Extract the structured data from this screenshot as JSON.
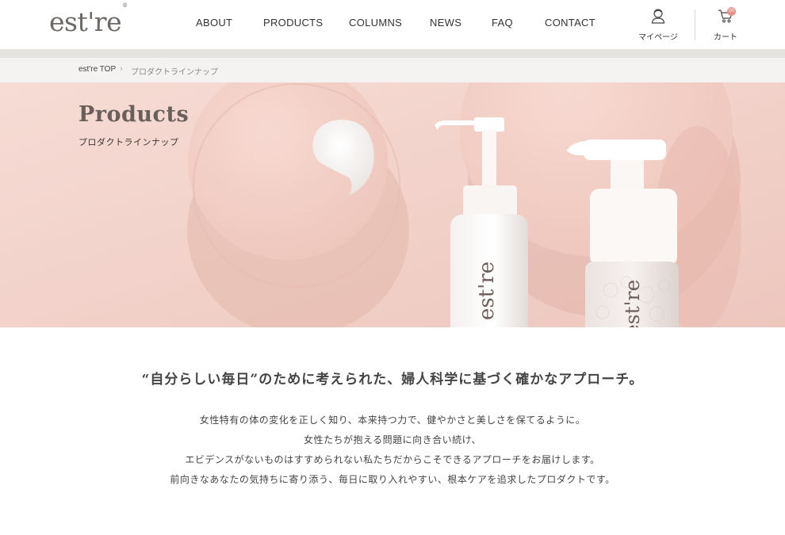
{
  "header": {
    "logo": "est're",
    "logo_mark": "®",
    "nav": [
      {
        "label": "ABOUT"
      },
      {
        "label": "PRODUCTS"
      },
      {
        "label": "COLUMNS"
      },
      {
        "label": "NEWS"
      },
      {
        "label": "FAQ"
      },
      {
        "label": "CONTACT"
      }
    ],
    "mypage_label": "マイページ",
    "cart_label": "カート",
    "cart_count": "00"
  },
  "breadcrumb": {
    "home": "est're TOP",
    "separator": "›",
    "current": "プロダクトラインナップ"
  },
  "hero": {
    "title": "Products",
    "subtitle": "プロダクトラインナップ",
    "bottle_brand": "est're"
  },
  "intro": {
    "heading": "“自分らしい毎日”のために考えられた、婦人科学に基づく確かなアプローチ。",
    "lines": [
      "女性特有の体の変化を正しく知り、本来持つ力で、健やかさと美しさを保てるように。",
      "女性たちが抱える問題に向き合い続け、",
      "エビデンスがないものはすすめられない私たちだからこそできるアプローチをお届けします。",
      "前向きなあなたの気持ちに寄り添う、毎日に取り入れやすい、根本ケアを追求したプロダクトです。"
    ]
  },
  "colors": {
    "hero_bg": "#f2d3cc",
    "band": "#e6e4de",
    "breadcrumb_bg": "#f4f3f1",
    "badge": "#e6918a",
    "logo": "#6b6866"
  }
}
